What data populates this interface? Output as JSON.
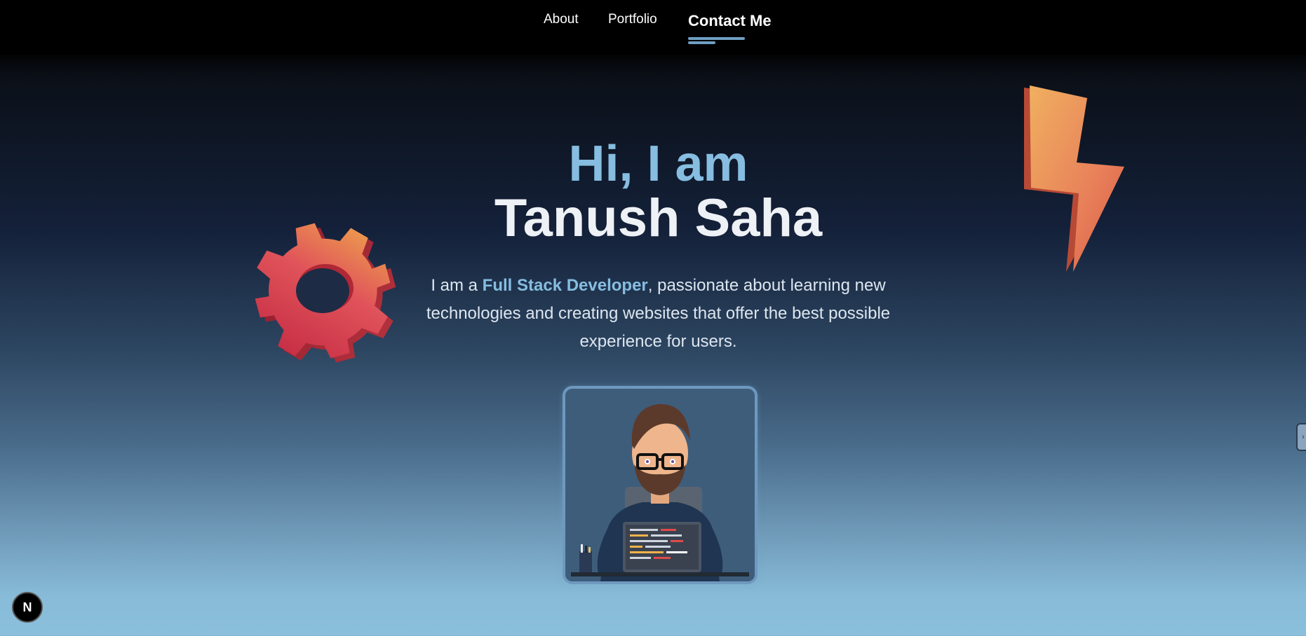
{
  "nav": {
    "items": [
      {
        "label": "About"
      },
      {
        "label": "Portfolio"
      },
      {
        "label": "Contact Me"
      }
    ]
  },
  "hero": {
    "greeting": "Hi, I am",
    "name": "Tanush Saha",
    "description_prefix": "I am a ",
    "description_highlight": "Full Stack Developer",
    "description_suffix": ", passionate about learning new technologies and creating websites that offer the best possible experience for users."
  },
  "badges": {
    "framework_badge": "N",
    "side_tab_icon": "›"
  },
  "colors": {
    "accent": "#86bde0",
    "name_text": "#eef1f5",
    "nav_bg": "#000000",
    "underline": "#6e9ec3"
  },
  "icons": {
    "gear": "gear-icon",
    "bolt": "lightning-bolt-icon",
    "avatar": "developer-avatar"
  }
}
